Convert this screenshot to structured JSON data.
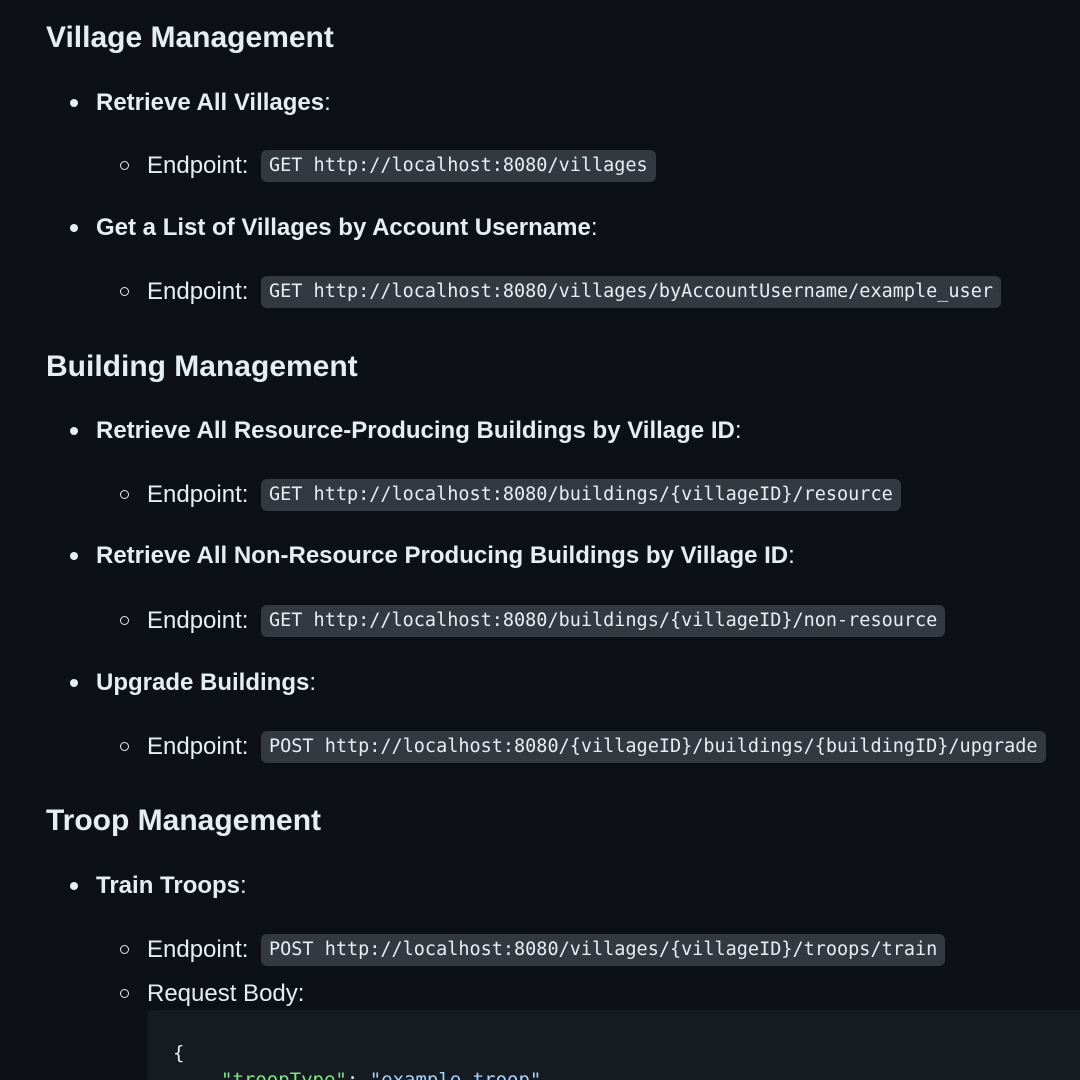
{
  "sections": {
    "village": {
      "title": "Village Management",
      "items": [
        {
          "label": "Retrieve All Villages",
          "endpoint_label": "Endpoint:",
          "endpoint": "GET http://localhost:8080/villages"
        },
        {
          "label": "Get a List of Villages by Account Username",
          "endpoint_label": "Endpoint:",
          "endpoint": "GET http://localhost:8080/villages/byAccountUsername/example_user"
        }
      ]
    },
    "building": {
      "title": "Building Management",
      "items": [
        {
          "label": "Retrieve All Resource-Producing Buildings by Village ID",
          "endpoint_label": "Endpoint:",
          "endpoint": "GET http://localhost:8080/buildings/{villageID}/resource"
        },
        {
          "label": "Retrieve All Non-Resource Producing Buildings by Village ID",
          "endpoint_label": "Endpoint:",
          "endpoint": "GET http://localhost:8080/buildings/{villageID}/non-resource"
        },
        {
          "label": "Upgrade Buildings",
          "endpoint_label": "Endpoint:",
          "endpoint": "POST http://localhost:8080/{villageID}/buildings/{buildingID}/upgrade"
        }
      ]
    },
    "troop": {
      "title": "Troop Management",
      "items": [
        {
          "label": "Train Troops",
          "endpoint_label": "Endpoint:",
          "endpoint": "POST http://localhost:8080/villages/{villageID}/troops/train",
          "body_label": "Request Body:"
        }
      ]
    }
  },
  "colon": ":",
  "code_block": {
    "line1": "{",
    "line2_key": "\"troopType\"",
    "line2_sep": ": ",
    "line2_value": "\"example_troop\""
  },
  "colors": {
    "background": "#0d1117",
    "text": "#e6edf3",
    "inline_code_bg": "#343941",
    "code_block_bg": "#161b22",
    "json_key": "#7ee787",
    "json_string": "#a5d6ff"
  }
}
